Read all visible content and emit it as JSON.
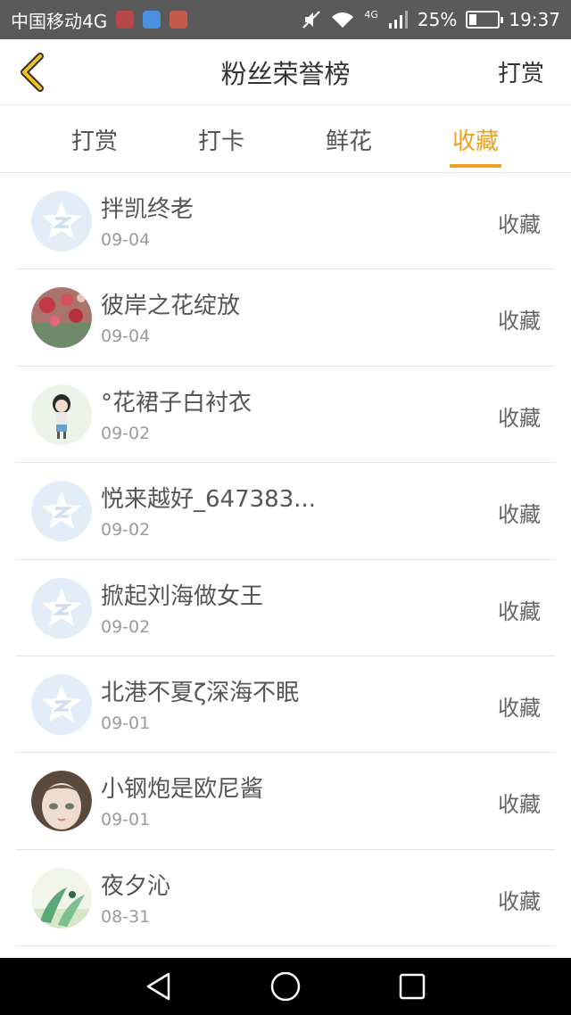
{
  "status_bar": {
    "carrier": "中国移动4G",
    "network": "4G",
    "battery": "25%",
    "battery_level": 0.25,
    "time": "19:37"
  },
  "header": {
    "title": "粉丝荣誉榜",
    "action": "打赏",
    "back_icon": "chevron-left-icon",
    "accent_color": "#f0a020"
  },
  "tabs": [
    {
      "label": "打赏",
      "active": false
    },
    {
      "label": "打卡",
      "active": false
    },
    {
      "label": "鲜花",
      "active": false
    },
    {
      "label": "收藏",
      "active": true
    }
  ],
  "list": [
    {
      "name": "拌凯终老",
      "date": "09-04",
      "action": "收藏",
      "avatar": "default-qzone-avatar"
    },
    {
      "name": "彼岸之花绽放",
      "date": "09-04",
      "action": "收藏",
      "avatar": "floral-photo-avatar"
    },
    {
      "name": "°花裙子白衬衣",
      "date": "09-02",
      "action": "收藏",
      "avatar": "cartoon-girl-avatar"
    },
    {
      "name": "悦来越好_647383...",
      "date": "09-02",
      "action": "收藏",
      "avatar": "default-qzone-avatar"
    },
    {
      "name": "掀起刘海做女王",
      "date": "09-02",
      "action": "收藏",
      "avatar": "default-qzone-avatar"
    },
    {
      "name": "北港不夏ζ深海不眠",
      "date": "09-01",
      "action": "收藏",
      "avatar": "default-qzone-avatar"
    },
    {
      "name": "小钢炮是欧尼酱",
      "date": "09-01",
      "action": "收藏",
      "avatar": "doll-face-avatar"
    },
    {
      "name": "夜夕沁",
      "date": "08-31",
      "action": "收藏",
      "avatar": "leaf-illustration-avatar"
    }
  ]
}
